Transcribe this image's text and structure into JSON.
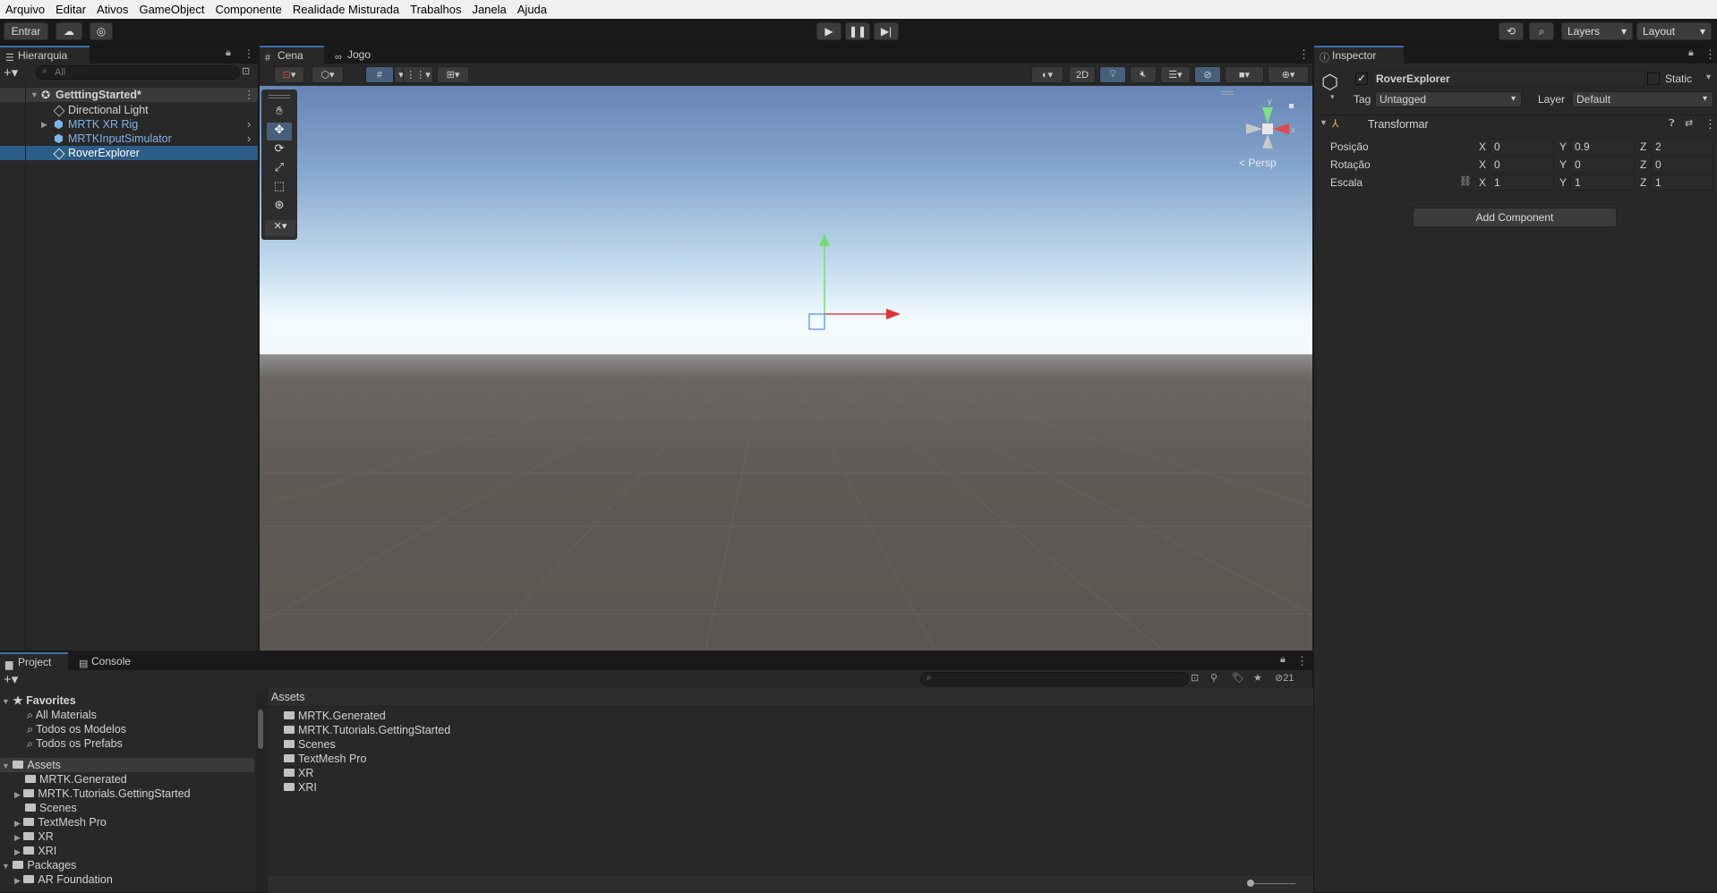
{
  "menu": [
    "Arquivo",
    "Editar",
    "Ativos",
    "GameObject",
    "Componente",
    "Realidade Misturada",
    "Trabalhos",
    "Janela",
    "Ajuda"
  ],
  "toolbar": {
    "signin_label": "Entrar",
    "layers_label": "Layers",
    "layout_label": "Layout"
  },
  "hierarchy": {
    "tab": "Hierarquia",
    "search_placeholder": "All",
    "scene": "GetttingStarted*",
    "items": [
      {
        "label": "Directional Light"
      },
      {
        "label": "MRTK XR Rig"
      },
      {
        "label": "MRTKInputSimulator"
      },
      {
        "label": "RoverExplorer"
      }
    ]
  },
  "scene_view": {
    "tabs": [
      "Cena",
      "Jogo"
    ],
    "mode_2d": "2D",
    "persp_label": "< Persp",
    "gizmo_y": "y",
    "gizmo_x": "x"
  },
  "inspector": {
    "tab": "Inspector",
    "object_name": "RoverExplorer",
    "static_label": "Static",
    "tag_label": "Tag",
    "tag_value": "Untagged",
    "layer_label": "Layer",
    "layer_value": "Default",
    "component": "Transformar",
    "position_label": "Posição",
    "rotation_label": "Rotação",
    "scale_label": "Escala",
    "axis_x": "X",
    "axis_y": "Y",
    "axis_z": "Z",
    "position": {
      "x": "0",
      "y": "0.9",
      "z": "2"
    },
    "rotation": {
      "x": "0",
      "y": "0",
      "z": "0"
    },
    "scale": {
      "x": "1",
      "y": "1",
      "z": "1"
    },
    "add_component": "Add Component"
  },
  "project": {
    "tabs": [
      "Project",
      "Console"
    ],
    "hidden_count": "21",
    "favorites_label": "Favorites",
    "favorites": [
      "All Materials",
      "Todos os Modelos",
      "Todos os Prefabs"
    ],
    "assets_label": "Assets",
    "asset_folders": [
      "MRTK.Generated",
      "MRTK.Tutorials.GettingStarted",
      "Scenes",
      "TextMesh Pro",
      "XR",
      "XRI"
    ],
    "packages_label": "Packages",
    "packages": [
      "AR Foundation"
    ],
    "breadcrumb": "Assets",
    "grid_items": [
      "MRTK.Generated",
      "MRTK.Tutorials.GettingStarted",
      "Scenes",
      "TextMesh Pro",
      "XR",
      "XRI"
    ]
  },
  "colors": {
    "accent": "#2c5d87",
    "selected_row": "#2c5d87",
    "prefab_text": "#7cb5ec",
    "sky_top": "#6a88b9",
    "ground": "#5a5550"
  }
}
